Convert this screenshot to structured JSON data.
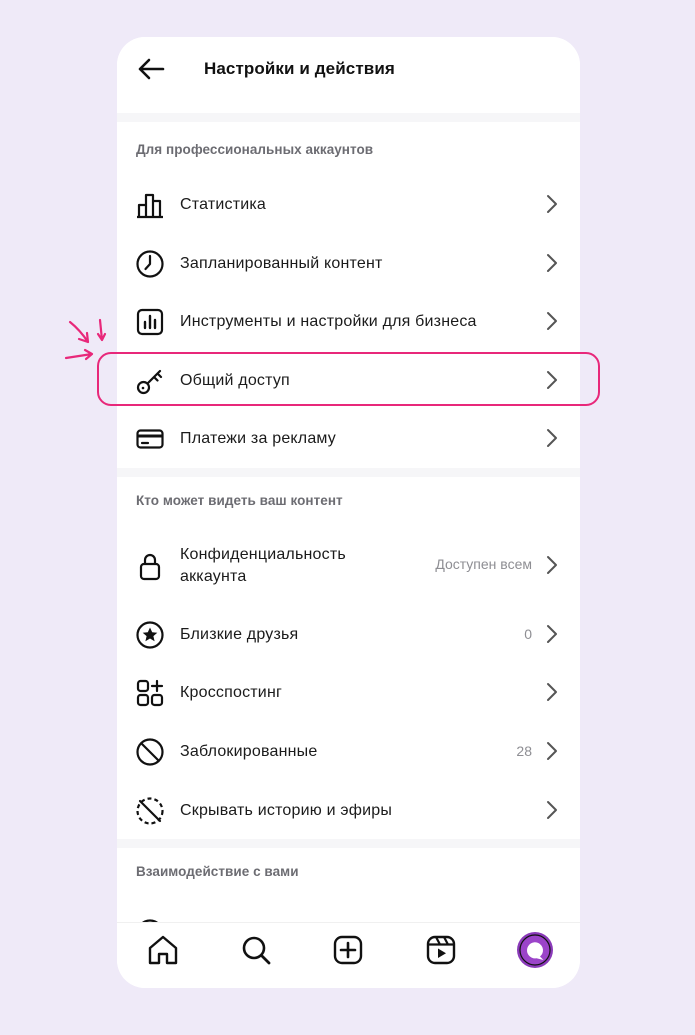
{
  "header": {
    "title": "Настройки и действия"
  },
  "sections": [
    {
      "title": "Для профессиональных аккаунтов",
      "items": [
        {
          "label": "Статистика",
          "icon": "bar-chart-icon"
        },
        {
          "label": "Запланированный контент",
          "icon": "clock-icon"
        },
        {
          "label": "Инструменты и настройки для бизнеса",
          "icon": "business-tools-icon"
        },
        {
          "label": "Общий доступ",
          "icon": "key-icon"
        },
        {
          "label": "Платежи за рекламу",
          "icon": "credit-card-icon"
        }
      ]
    },
    {
      "title": "Кто может видеть ваш контент",
      "items": [
        {
          "label": "Конфиденциальность аккаунта",
          "label_line1": "Конфиденциальность",
          "label_line2": "аккаунта",
          "value": "Доступен всем",
          "icon": "lock-icon"
        },
        {
          "label": "Близкие друзья",
          "value": "0",
          "icon": "star-circle-icon"
        },
        {
          "label": "Кросспостинг",
          "icon": "crosspost-icon"
        },
        {
          "label": "Заблокированные",
          "value": "28",
          "icon": "blocked-icon"
        },
        {
          "label": "Скрывать историю и эфиры",
          "icon": "hide-story-icon"
        }
      ]
    },
    {
      "title": "Взаимодействие с вами",
      "items": []
    }
  ],
  "bottom_nav": [
    "home-icon",
    "search-icon",
    "create-icon",
    "reels-icon",
    "profile-avatar"
  ],
  "colors": {
    "highlight": "#e8287a",
    "background": "#efeaf8",
    "avatar": "#8a3ab9"
  }
}
